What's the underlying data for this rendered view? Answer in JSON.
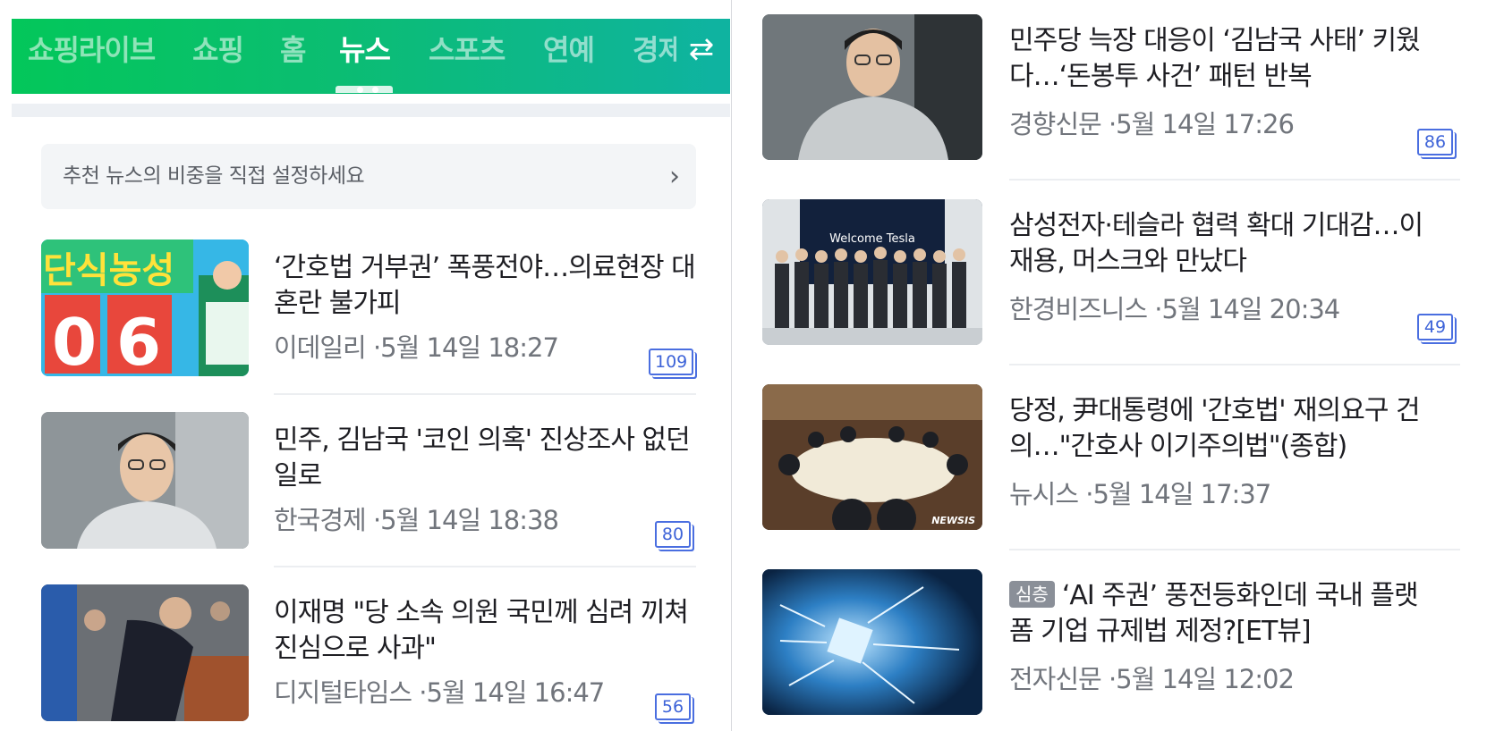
{
  "tabs": [
    {
      "label": "쇼핑라이브",
      "active": false
    },
    {
      "label": "쇼핑",
      "active": false
    },
    {
      "label": "홈",
      "active": false
    },
    {
      "label": "뉴스",
      "active": true
    },
    {
      "label": "스포츠",
      "active": false
    },
    {
      "label": "연예",
      "active": false
    },
    {
      "label": "경제",
      "active": false
    }
  ],
  "tab_swap_icon": "swap-arrows-icon",
  "setting_banner": {
    "label": "추천 뉴스의 비중을 직접 설정하세요",
    "icon": "chevron-right-icon"
  },
  "left_articles": [
    {
      "title": "‘간호법 거부권’ 폭풍전야…의료현장 대혼란 불가피",
      "source": "이데일리",
      "time": "5월 14일 18:27",
      "comments": "109",
      "thumb_text": [
        "단식농성",
        "0",
        "6"
      ]
    },
    {
      "title": "민주, 김남국 '코인 의혹' 진상조사 없던 일로",
      "source": "한국경제",
      "time": "5월 14일 18:38",
      "comments": "80"
    },
    {
      "title": "이재명 \"당 소속 의원 국민께 심려 끼쳐 진심으로 사과\"",
      "source": "디지털타임스",
      "time": "5월 14일 16:47",
      "comments": "56"
    }
  ],
  "right_articles": [
    {
      "title": "민주당 늑장 대응이 ‘김남국 사태’ 키웠다…‘돈봉투 사건’ 패턴 반복",
      "source": "경향신문",
      "time": "5월 14일 17:26",
      "comments": "86"
    },
    {
      "title": "삼성전자·테슬라 협력 확대 기대감…이재용, 머스크와 만났다",
      "source": "한경비즈니스",
      "time": "5월 14일 20:34",
      "comments": "49",
      "thumb_text": "Welcome Tesla"
    },
    {
      "title": "당정, 尹대통령에 '간호법' 재의요구 건의…\"간호사 이기주의법\"(종합)",
      "source": "뉴시스",
      "time": "5월 14일 17:37",
      "comments": "",
      "thumb_text": "NEWSIS"
    },
    {
      "tag": "심층",
      "title": "‘AI 주권’ 풍전등화인데 국내 플랫폼 기업 규제법 제정?[ET뷰]",
      "source": "전자신문",
      "time": "5월 14일 12:02",
      "comments": ""
    }
  ],
  "meta_separator": " ·"
}
